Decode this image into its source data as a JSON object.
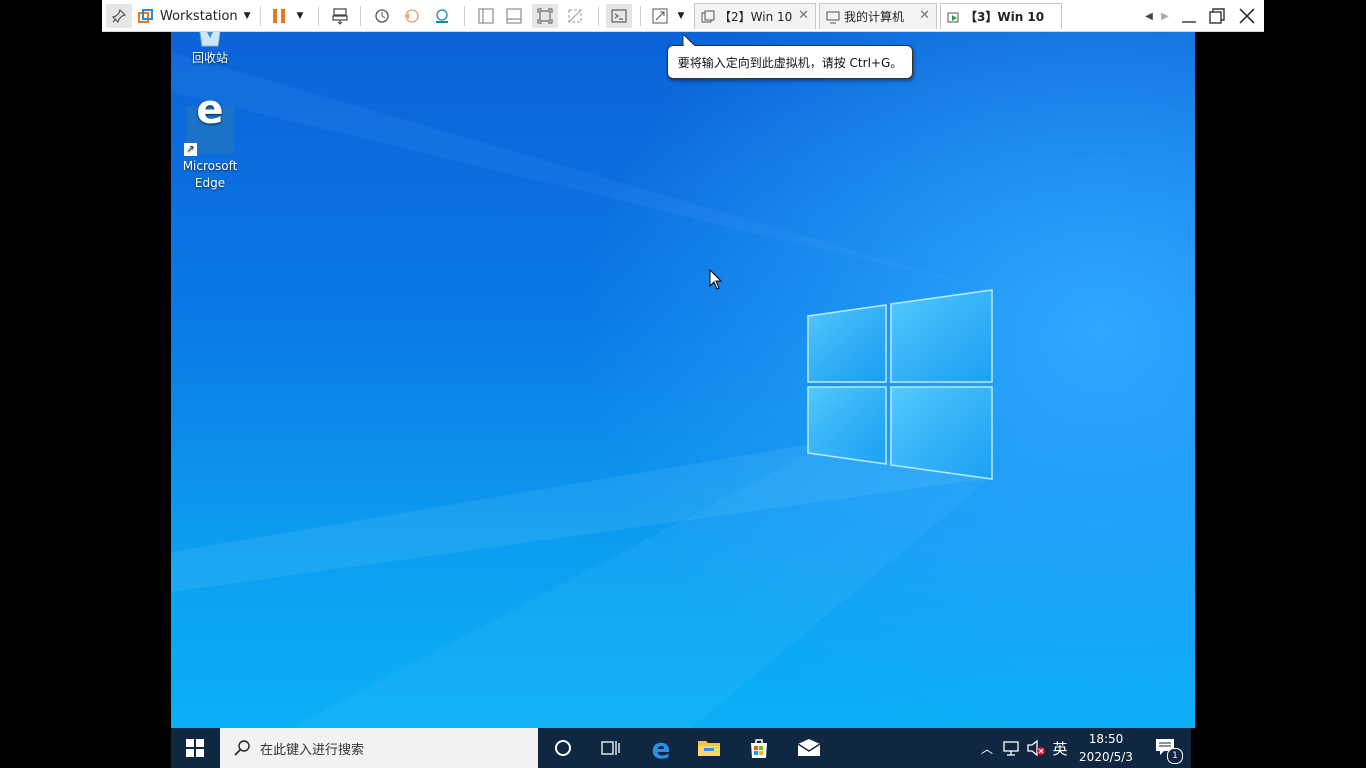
{
  "toolbar": {
    "workstation_label": "Workstation",
    "tabs": [
      {
        "label": "【2】Win 10",
        "icon": "vm-icon"
      },
      {
        "label": "我的计算机",
        "icon": "computer-icon"
      },
      {
        "label": "【3】Win 10",
        "icon": "vm-running-icon"
      }
    ]
  },
  "tooltip": {
    "text": "要将输入定向到此虚拟机，请按 Ctrl+G。"
  },
  "desktop": {
    "icons": [
      {
        "label": "回收站",
        "icon": "recycle-bin-icon"
      },
      {
        "label": "Microsoft Edge",
        "icon": "edge-icon"
      }
    ]
  },
  "taskbar": {
    "search_placeholder": "在此键入进行搜索",
    "ime": "英",
    "time": "18:50",
    "date": "2020/5/3",
    "notification_count": "1"
  },
  "colors": {
    "desktop": "#0a78e6",
    "taskbar": "#0f2740",
    "accent": "#e87722"
  }
}
